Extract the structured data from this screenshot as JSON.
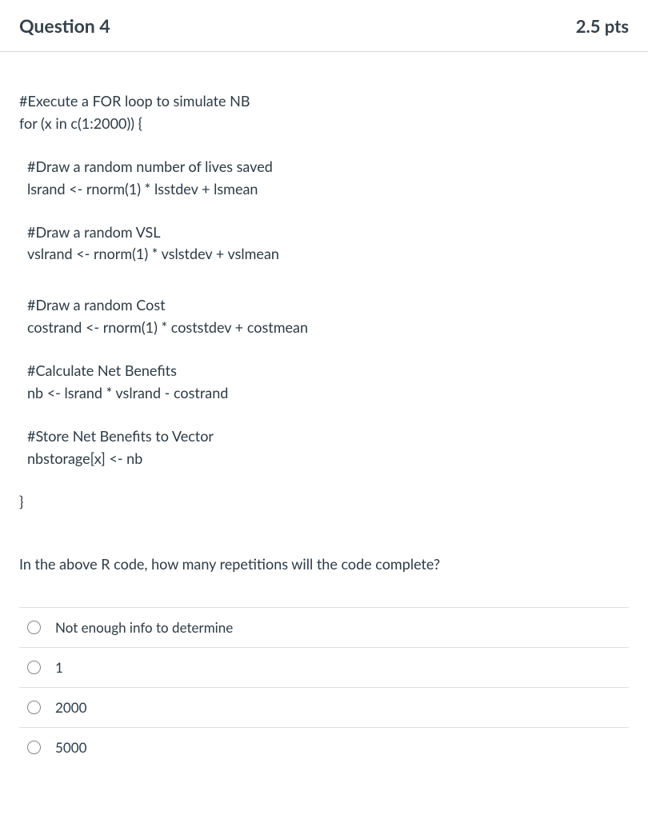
{
  "header": {
    "title": "Question 4",
    "points": "2.5 pts"
  },
  "code": {
    "s0_l0": "#Execute a FOR loop to simulate NB",
    "s0_l1": "for (x in c(1:2000)) {",
    "s1_l0": "#Draw a random number of lives saved",
    "s1_l1": "lsrand <- rnorm(1) * lsstdev + lsmean",
    "s2_l0": "#Draw a random VSL",
    "s2_l1": "vslrand <- rnorm(1) * vslstdev + vslmean",
    "s3_l0": "#Draw a random Cost",
    "s3_l1": "costrand <- rnorm(1) * coststdev + costmean",
    "s4_l0": "#Calculate Net Benefits",
    "s4_l1": "nb <- lsrand * vslrand - costrand",
    "s5_l0": "#Store Net Benefits to Vector",
    "s5_l1": "nbstorage[x] <- nb",
    "s6_l0": "}"
  },
  "prompt": "In the above R code, how many repetitions will the code complete?",
  "options": {
    "o0": "Not enough info to determine",
    "o1": "1",
    "o2": "2000",
    "o3": "5000"
  }
}
